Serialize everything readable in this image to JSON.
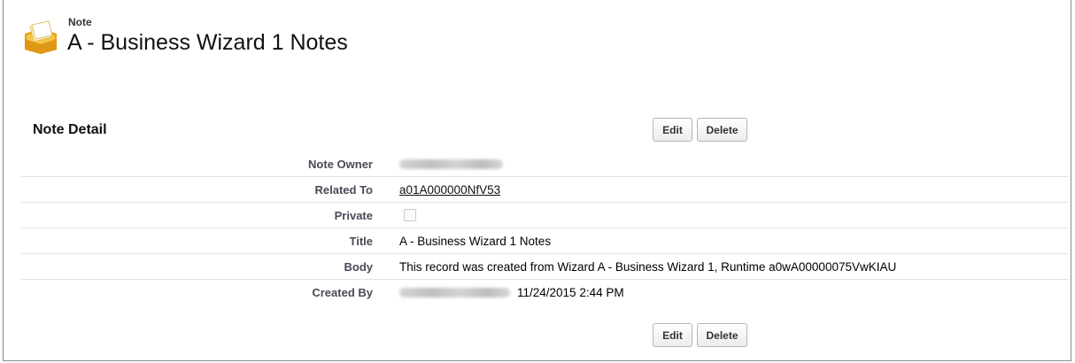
{
  "header": {
    "type_label": "Note",
    "title": "A - Business Wizard 1 Notes",
    "icon": "note-folder-icon"
  },
  "detail": {
    "section_title": "Note Detail",
    "edit_label": "Edit",
    "delete_label": "Delete",
    "fields": {
      "owner": {
        "label": "Note Owner",
        "value": ""
      },
      "related_to": {
        "label": "Related To",
        "value": "a01A000000NfV53"
      },
      "private": {
        "label": "Private",
        "checked": false
      },
      "title": {
        "label": "Title",
        "value": "A - Business Wizard 1 Notes"
      },
      "body": {
        "label": "Body",
        "value": "This record was created from Wizard A - Business Wizard 1, Runtime a0wA00000075VwKIAU"
      },
      "created_by": {
        "label": "Created By",
        "value": "11/24/2015 2:44 PM"
      }
    }
  },
  "colors": {
    "label_text": "#4a4a56",
    "row_divider": "#e3e3e3",
    "frame_border": "#8a8a8a"
  }
}
